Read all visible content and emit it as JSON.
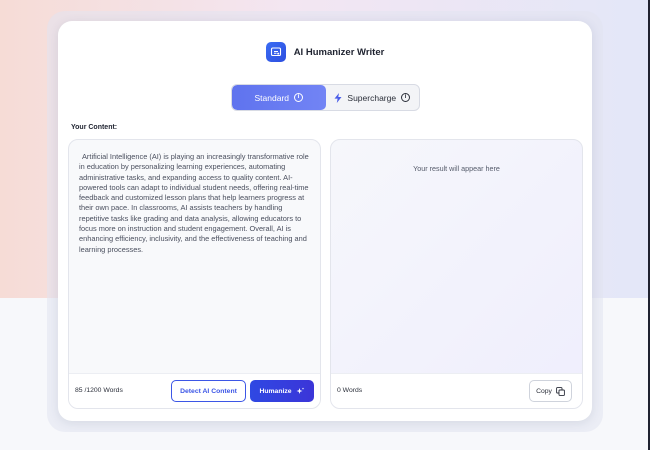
{
  "app": {
    "title": "AI Humanizer Writer"
  },
  "mode_switch": {
    "standard_label": "Standard",
    "supercharge_label": "Supercharge",
    "active": "Standard"
  },
  "input": {
    "section_label": "Your Content:",
    "text": "Artificial Intelligence (AI) is playing an increasingly transformative role in education by personalizing learning experiences, automating administrative tasks, and expanding access to quality content. AI-powered tools can adapt to individual student needs, offering real-time feedback and customized lesson plans that help learners progress at their own pace. In classrooms, AI assists teachers by handling repetitive tasks like grading and data analysis, allowing educators to focus more on instruction and student engagement. Overall, AI is enhancing efficiency, inclusivity, and the effectiveness of teaching and learning processes.",
    "word_count": "85 /1200 Words",
    "detect_label": "Detect AI Content",
    "humanize_label": "Humanize"
  },
  "output": {
    "placeholder": "Your result will appear here",
    "word_count": "0 Words",
    "copy_label": "Copy"
  },
  "colors": {
    "accent": "#3c56e6",
    "standard_active": "#6a7cf2"
  }
}
